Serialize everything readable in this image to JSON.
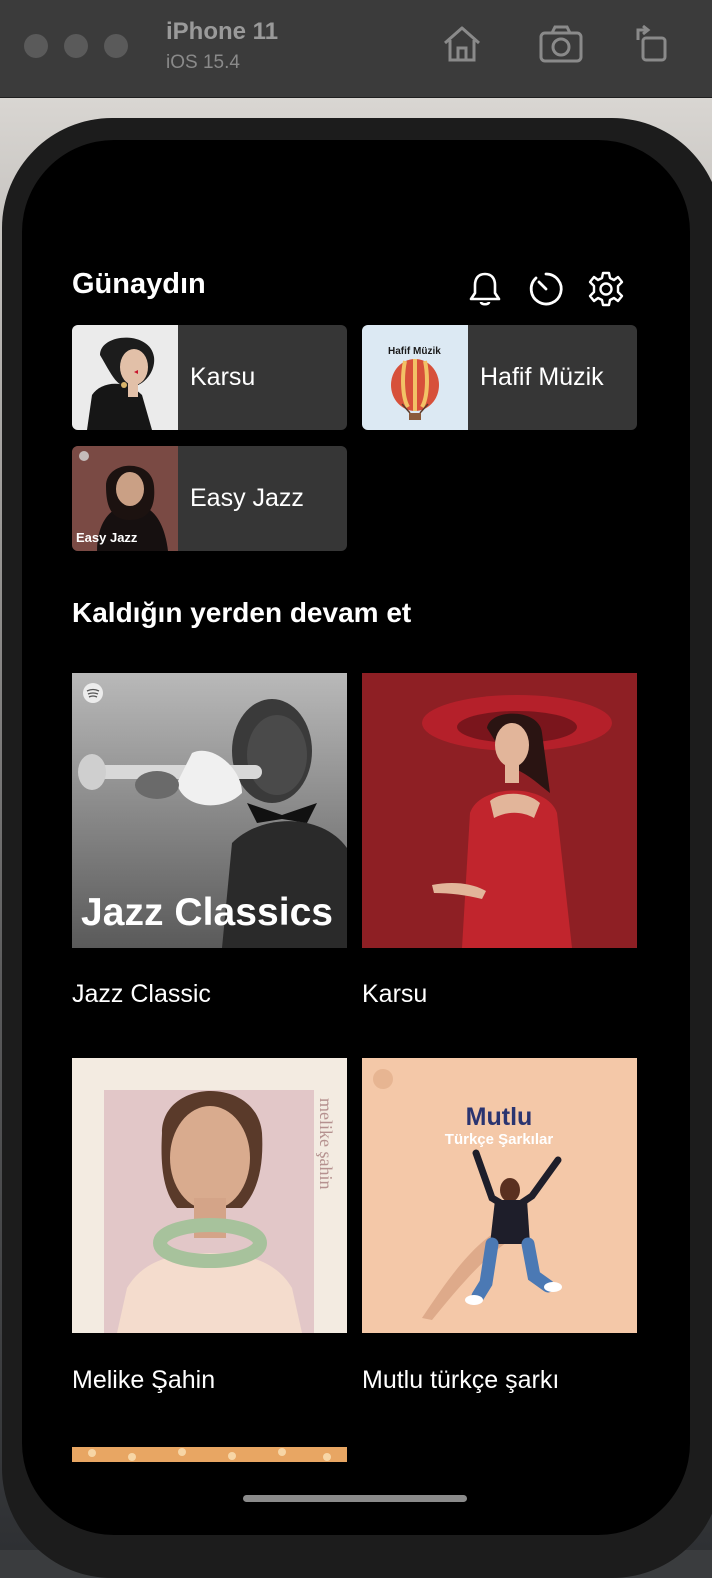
{
  "simulator": {
    "device_name": "iPhone 11",
    "os_version": "iOS 15.4",
    "icons": [
      "home-icon",
      "screenshot-icon",
      "rotate-icon"
    ]
  },
  "header": {
    "greeting": "Günaydın",
    "icons": [
      "bell-icon",
      "history-icon",
      "settings-icon"
    ]
  },
  "quick_access": [
    {
      "label": "Karsu"
    },
    {
      "label": "Hafif Müzik",
      "cover_text": "Hafif Müzik"
    },
    {
      "label": "Easy Jazz",
      "cover_text": "Easy Jazz"
    }
  ],
  "continue_section": {
    "title": "Kaldığın yerden devam et",
    "items": [
      {
        "label": "Jazz Classic",
        "cover_text": "Jazz Classics"
      },
      {
        "label": "Karsu"
      },
      {
        "label": "Melike Şahin",
        "cover_text": "melike şahin"
      },
      {
        "label": "Mutlu türkçe şarkı",
        "cover_title": "Mutlu",
        "cover_subtitle": "Türkçe Şarkılar"
      }
    ]
  },
  "colors": {
    "background": "#000000",
    "card": "#363636",
    "text": "#ffffff",
    "jazz_cover": "#8a8a8a",
    "karsu_cover": "#8e1f24",
    "melike_cover": "#f1e6da",
    "mutlu_cover": "#f4c8a8"
  }
}
